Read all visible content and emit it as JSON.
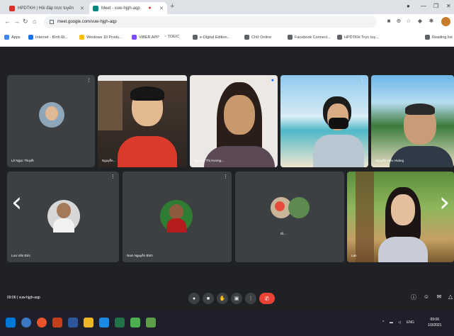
{
  "browser": {
    "tabs": [
      {
        "label": "HPDTKH | Hỏi đáp trực tuyến",
        "active": false
      },
      {
        "label": "Meet - vuw-hjgh-aqp",
        "active": true
      }
    ],
    "address": "meet.google.com/vuw-hjgh-aqp",
    "bookmarks": [
      {
        "label": "Apps"
      },
      {
        "label": "Internet - Bình Đị..."
      },
      {
        "label": "Windows 10 Produ..."
      },
      {
        "label": "VIBER APP"
      },
      {
        "label": "~ TOEIC"
      },
      {
        "label": "e-Digital Edition..."
      },
      {
        "label": "Chữ Online"
      },
      {
        "label": "Facebook Connect..."
      },
      {
        "label": "HPDTKH Trực tuy..."
      },
      {
        "label": "Reading list"
      }
    ]
  },
  "meet": {
    "participants_row1": [
      {
        "name": "Lê Ngọc Thuyết"
      },
      {
        "name": "Nguyễn..."
      },
      {
        "name": "Nguyễn Thị Hương..."
      },
      {
        "name": ""
      },
      {
        "name": "Nguyễn Hữu Hoàng"
      }
    ],
    "participants_row2": [
      {
        "name": "Lưu Văn Đức"
      },
      {
        "name": "Nam Nguyễn Bình"
      },
      {
        "name": "Dl..."
      },
      {
        "name": "Lan"
      }
    ],
    "meeting_info": "09:06 | vuw-hjgh-aqp"
  },
  "taskbar": {
    "time": "09:06",
    "date": "1/3/2021",
    "lang": "ENG"
  },
  "colors": {
    "meet_bg": "#202124",
    "tile_bg": "#3c4043",
    "end_call": "#ea4335"
  }
}
